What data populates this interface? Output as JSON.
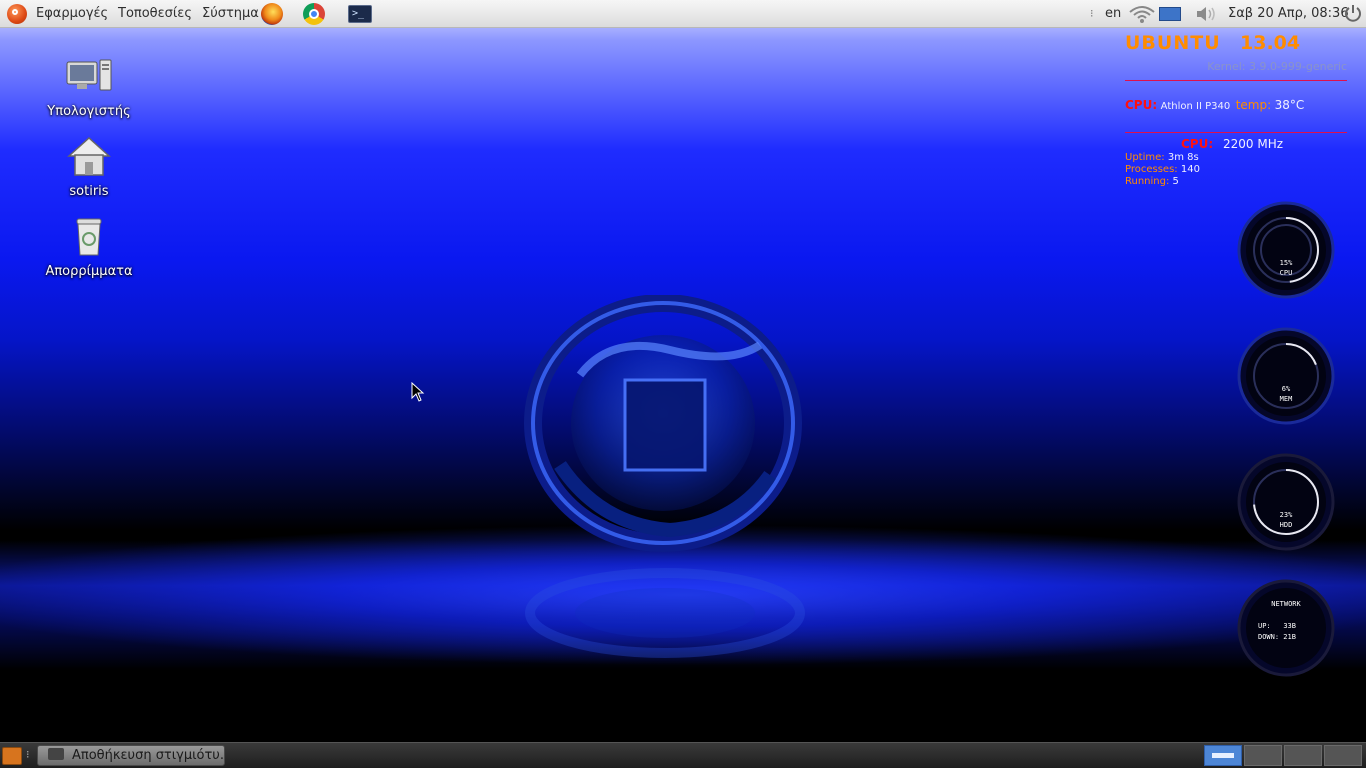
{
  "top_panel": {
    "menus": [
      "Εφαρμογές",
      "Τοποθεσίες",
      "Σύστημα"
    ],
    "keyboard_layout": "en",
    "clock": "Σαβ 20 Απρ, 08:36"
  },
  "desktop_icons": [
    {
      "label": "Υπολογιστής",
      "icon": "computer-icon"
    },
    {
      "label": "sotiris",
      "icon": "home-folder-icon"
    },
    {
      "label": "Απορρίμματα",
      "icon": "trash-icon"
    }
  ],
  "conky": {
    "distro": "UBUNTU",
    "version": "13.04",
    "kernel": "Kernel: 3.9.0-999-generic",
    "cpu_label": "CPU:",
    "cpu_model": "Athlon II P340",
    "temp_label": "temp:",
    "temp_value": "38°C",
    "freq_label": "CPU:",
    "freq_value": "2200 MHz",
    "uptime_label": "Uptime:",
    "uptime_value": "3m 8s",
    "processes_label": "Processes:",
    "processes_value": "140",
    "running_label": "Running:",
    "running_value": "5"
  },
  "rings": [
    {
      "value_text": "15%",
      "label": "CPU",
      "fraction": 0.15
    },
    {
      "value_text": "6%",
      "label": "MEM",
      "fraction": 0.06
    },
    {
      "value_text": "23%",
      "label": "HDD",
      "fraction": 0.23
    }
  ],
  "network_ring": {
    "title": "NETWORK",
    "up_label": "UP:",
    "up_value": "33B",
    "down_label": "DOWN:",
    "down_value": "21B"
  },
  "taskbar": {
    "task_label": "Αποθήκευση στιγμιότυ..."
  },
  "workspaces": {
    "count": 4,
    "active": 1
  },
  "colors": {
    "conky_orange": "#ff8c00",
    "conky_red": "#ff1010",
    "workspace_active": "#4d86d6"
  }
}
